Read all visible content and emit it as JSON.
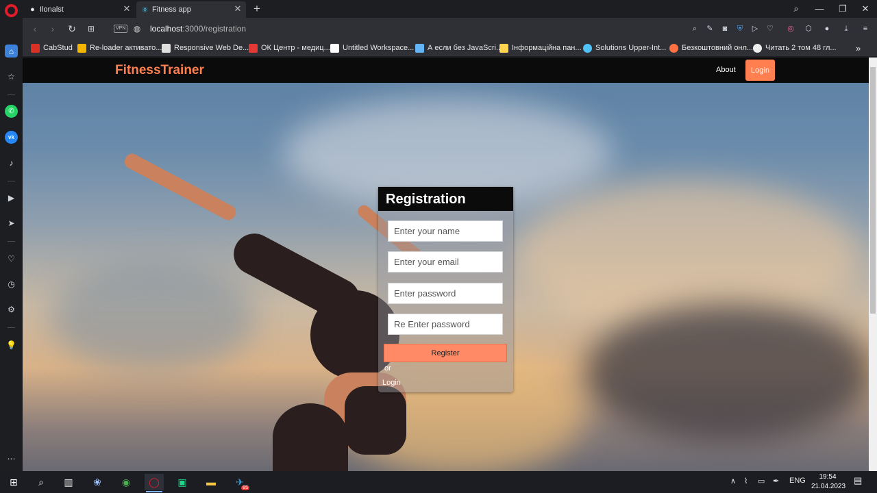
{
  "browser": {
    "tabs": [
      {
        "title": "Ilonalst",
        "icon": "github-icon"
      },
      {
        "title": "Fitness app",
        "icon": "react-icon",
        "active": true
      }
    ],
    "url_host": "localhost",
    "url_path": ":3000/registration",
    "vpn_label": "VPN",
    "bookmarks": [
      {
        "label": "CabStud",
        "color": "#d93025"
      },
      {
        "label": "Re-loader активато...",
        "color": "#f4b400"
      },
      {
        "label": "Responsive Web De...",
        "color": "#1a1a2e"
      },
      {
        "label": "ОК Центр - медиц...",
        "color": "#e53935"
      },
      {
        "label": "Untitled Workspace...",
        "color": "#ffffff"
      },
      {
        "label": "А если без JavaScri...",
        "color": "#64b5f6"
      },
      {
        "label": "Інформаційна пан...",
        "color": "#ffd54f"
      },
      {
        "label": "Solutions Upper-Int...",
        "color": "#4fc3f7"
      },
      {
        "label": "Безкоштовний онл...",
        "color": "#ff7043"
      },
      {
        "label": "Читать 2 том 48 гл...",
        "color": "#eeeeee"
      }
    ],
    "more_bookmarks": "»"
  },
  "app": {
    "brand": "FitnessTrainer",
    "nav_about": "About",
    "nav_login": "Login"
  },
  "registration": {
    "title": "Registration",
    "name_placeholder": "Enter your name",
    "email_placeholder": "Enter your email",
    "password_placeholder": "Enter password",
    "reenter_placeholder": "Re Enter password",
    "register_label": "Register",
    "or_text": "or",
    "login_link": "Login"
  },
  "taskbar": {
    "lang": "ENG",
    "time": "19:54",
    "date": "21.04.2023",
    "telegram_badge": "85"
  },
  "colors": {
    "accent": "#ff7f50",
    "register_button": "#ff8a65",
    "navbar": "#0b0b0b"
  }
}
